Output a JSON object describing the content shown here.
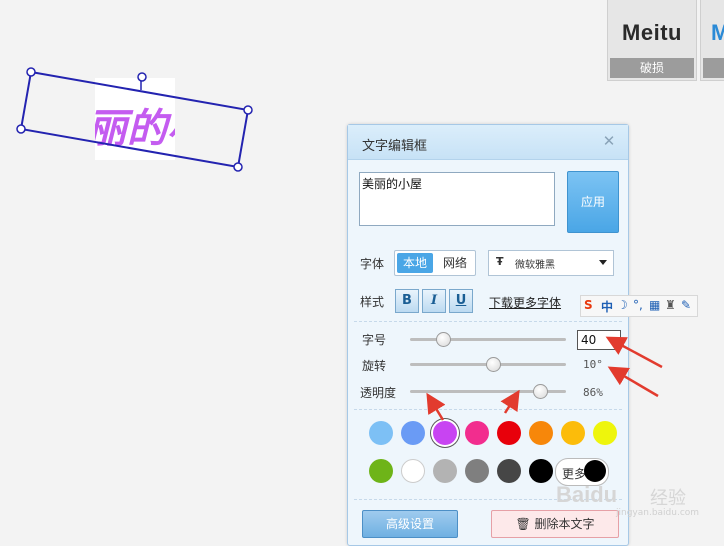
{
  "effect_thumbs": [
    {
      "logo": "Meitu",
      "caption": "破损"
    },
    {
      "logo": "M",
      "caption": ""
    }
  ],
  "canvas_text": "丽的小",
  "panel": {
    "title": "文字编辑框",
    "text_value": "美丽的小屋",
    "apply_label": "应用",
    "font_label": "字体",
    "font_source_local": "本地",
    "font_source_net": "网络",
    "font_name": "微软雅黑",
    "style_label": "样式",
    "bold_label": "B",
    "italic_label": "I",
    "underline_label": "U",
    "more_fonts_link": "下载更多字体",
    "size_label": "字号",
    "size_value": "40",
    "size_level": 0.18,
    "rotate_label": "旋转",
    "rotate_value": "10°",
    "rotate_level": 0.53,
    "opacity_label": "透明度",
    "opacity_value": "86%",
    "opacity_level": 0.86,
    "colors_row1": [
      "#7dc0f5",
      "#6a9bf5",
      "#c844f2",
      "#f22d8e",
      "#e8000b",
      "#f7870a",
      "#fcbc0a",
      "#eef50c"
    ],
    "colors_row2": [
      "#6eb418",
      "#ffffff",
      "#b3b3b3",
      "#7f7f7f",
      "#464646",
      "#000000"
    ],
    "selected_color": "#c844f2",
    "more_colors_label": "更多",
    "advanced_label": "高级设置",
    "delete_label": "删除本文字"
  },
  "ime_toolbar": {
    "brand": "S",
    "mode": "中"
  },
  "watermark": {
    "logo": "Baidu",
    "text": "经验",
    "sub": "jingyan.baidu.com"
  }
}
